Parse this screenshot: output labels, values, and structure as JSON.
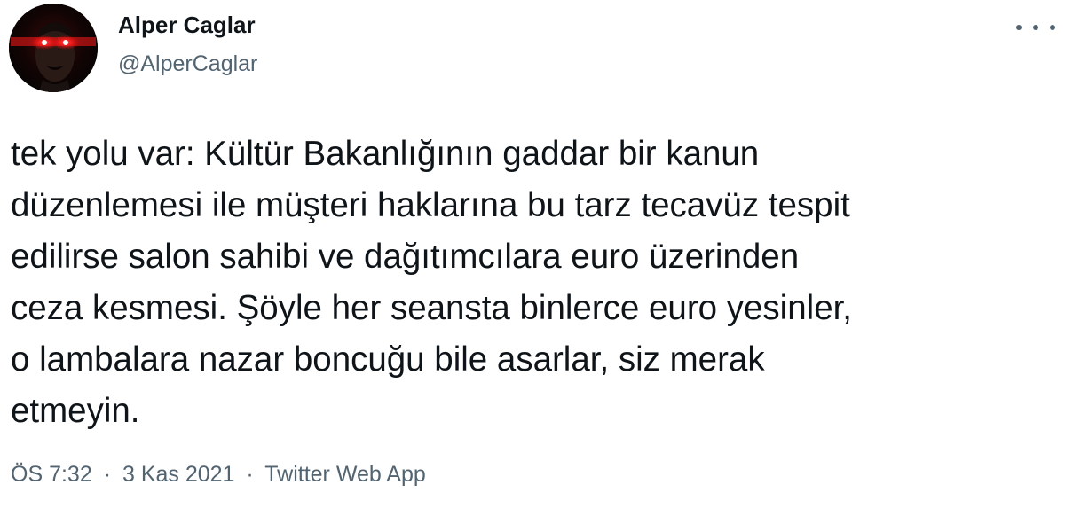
{
  "author": {
    "name": "Alper Caglar",
    "handle": "@AlperCaglar",
    "avatar_icon": "glowing-eyes-face-avatar"
  },
  "menu": {
    "icon": "more-horizontal-icon"
  },
  "tweet": {
    "lines": [
      "tek yolu var: Kültür Bakanlığının gaddar bir kanun",
      "düzenlemesi ile müşteri haklarına bu tarz tecavüz tespit",
      "edilirse salon sahibi ve dağıtımcılara euro üzerinden",
      "ceza kesmesi. Şöyle her seansta binlerce euro yesinler,",
      "o lambalara nazar boncuğu bile asarlar, siz merak",
      "etmeyin."
    ]
  },
  "meta": {
    "time": "ÖS 7:32",
    "separator": "·",
    "date": "3 Kas 2021",
    "source": "Twitter Web App"
  },
  "colors": {
    "text": "#0f1419",
    "secondary": "#536471",
    "background": "#ffffff"
  }
}
